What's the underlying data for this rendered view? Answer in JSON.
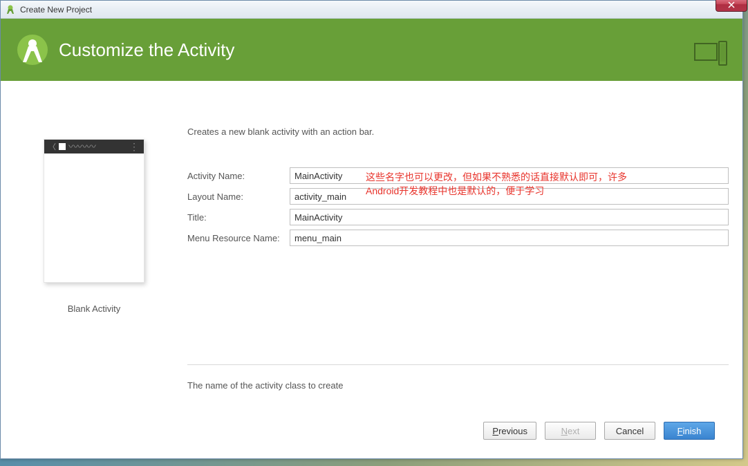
{
  "window": {
    "title": "Create New Project"
  },
  "header": {
    "heading": "Customize the Activity"
  },
  "content": {
    "description": "Creates a new blank activity with an action bar.",
    "preview_label": "Blank Activity",
    "annotation": "这些名字也可以更改，但如果不熟悉的话直接默认即可，许多Android开发教程中也是默认的，便于学习",
    "helper_text": "The name of the activity class to create"
  },
  "form": {
    "activity_name": {
      "label": "Activity Name:",
      "value": "MainActivity"
    },
    "layout_name": {
      "label": "Layout Name:",
      "value": "activity_main"
    },
    "title_field": {
      "label": "Title:",
      "value": "MainActivity"
    },
    "menu_resource": {
      "label": "Menu Resource Name:",
      "value": "menu_main"
    }
  },
  "buttons": {
    "previous": "Previous",
    "next": "Next",
    "cancel": "Cancel",
    "finish": "Finish"
  }
}
